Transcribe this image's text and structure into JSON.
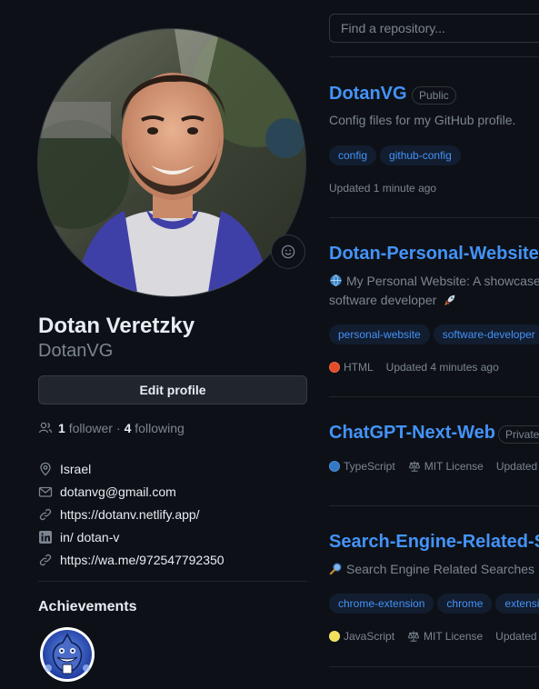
{
  "profile": {
    "full_name": "Dotan Veretzky",
    "username": "DotanVG",
    "edit_label": "Edit profile",
    "followers_count": "1",
    "followers_label": "follower",
    "separator": "·",
    "following_count": "4",
    "following_label": "following",
    "details": [
      {
        "icon": "location-icon",
        "text": "Israel"
      },
      {
        "icon": "mail-icon",
        "text": "dotanvg@gmail.com"
      },
      {
        "icon": "link-icon",
        "text": "https://dotanv.netlify.app/"
      },
      {
        "icon": "linkedin-icon",
        "text": "in/ dotan-v"
      },
      {
        "icon": "link-icon",
        "text": "https://wa.me/972547792350"
      }
    ],
    "achievements_title": "Achievements"
  },
  "repos_search": {
    "placeholder": "Find a repository..."
  },
  "repos": [
    {
      "name": "DotanVG",
      "visibility": "Public",
      "description": "Config files for my GitHub profile.",
      "topics": [
        "config",
        "github-config"
      ],
      "updated": "Updated 1 minute ago"
    },
    {
      "name": "Dotan-Personal-Website",
      "description_emoji": "globe-icon",
      "description": "My Personal Website: A showcase",
      "description_line2": "software developer",
      "description_line2_emoji": "rocket-icon",
      "topics": [
        "personal-website",
        "software-developer"
      ],
      "language": "HTML",
      "language_color": "#e34c26",
      "updated": "Updated 4 minutes ago"
    },
    {
      "name": "ChatGPT-Next-Web",
      "visibility": "Private",
      "language": "TypeScript",
      "language_color": "#3178c6",
      "license": "MIT License",
      "updated": "Updated"
    },
    {
      "name": "Search-Engine-Related-Se",
      "description_emoji": "magnifier-icon",
      "description": "Search Engine Related Searches M",
      "topics": [
        "chrome-extension",
        "chrome",
        "extensi"
      ],
      "language": "JavaScript",
      "language_color": "#f1e05a",
      "license": "MIT License",
      "updated": "Updated"
    }
  ]
}
